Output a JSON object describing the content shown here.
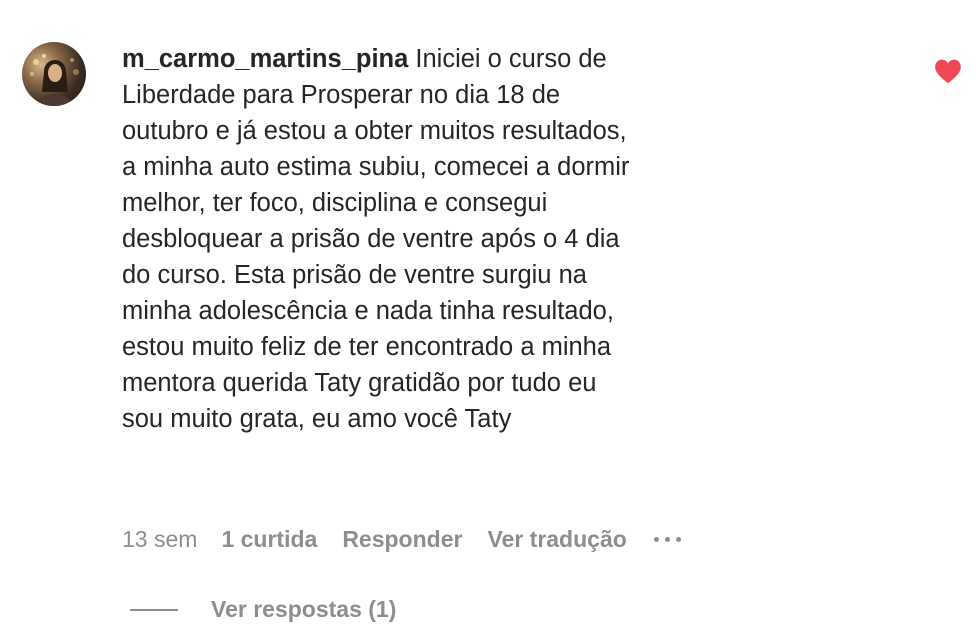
{
  "comment": {
    "username": "m_carmo_martins_pina",
    "text": "Iniciei o curso de Liberdade para Prosperar no dia 18 de outubro e já estou a obter muitos resultados, a minha auto estima subiu, comecei a dormir melhor, ter foco, disciplina e consegui desbloquear a prisão de ventre após o 4 dia do curso. Esta prisão de ventre surgiu na minha adolescência e nada tinha resultado, estou muito feliz de ter encontrado a minha mentora querida Taty gratidão por tudo eu sou muito grata, eu amo você Taty",
    "time": "13 sem",
    "likes_label": "1 curtida",
    "reply_label": "Responder",
    "translate_label": "Ver tradução",
    "view_replies_label": "Ver respostas (1)",
    "liked": true
  },
  "colors": {
    "text": "#262626",
    "secondary": "#8e8e8e",
    "heart": "#ed4956"
  },
  "icons": {
    "like": "heart-icon",
    "more": "more-options-icon"
  }
}
